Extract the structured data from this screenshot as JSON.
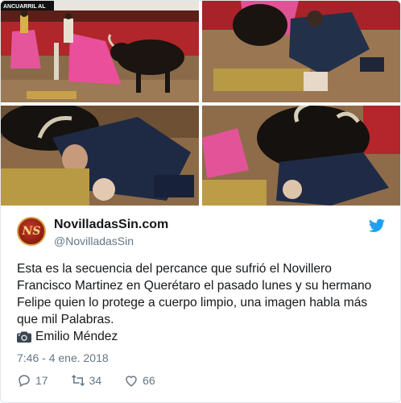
{
  "photos": {
    "banner_text": "ANCUARRIL AL"
  },
  "profile": {
    "avatar_letters": "NS",
    "display_name": "NovilladasSin.com",
    "handle": "@NovilladasSin"
  },
  "tweet": {
    "lines": [
      "Esta es la secuencia del percance que sufrió el Novillero",
      "Francisco Martinez en Querétaro el pasado lunes y su hermano",
      "Felipe quien lo protege a cuerpo limpio, una imagen habla más",
      "que mil Palabras."
    ],
    "credit": "Emilio Méndez"
  },
  "meta": {
    "timestamp": "7:46 - 4 ene. 2018"
  },
  "actions": {
    "replies": "17",
    "retweets": "34",
    "likes": "66"
  },
  "colors": {
    "twitter_blue": "#1da1f2",
    "muted": "#657786",
    "text": "#14171a",
    "border": "#e1e8ed"
  },
  "icons": [
    "twitter-bird-icon",
    "camera-icon",
    "reply-icon",
    "retweet-icon",
    "like-icon"
  ]
}
